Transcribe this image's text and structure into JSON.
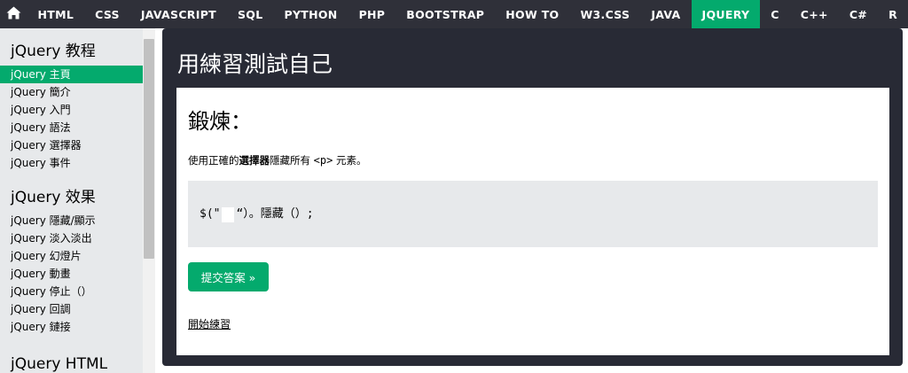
{
  "nav": {
    "home_icon": "home-icon",
    "items": [
      {
        "label": "HTML"
      },
      {
        "label": "CSS"
      },
      {
        "label": "JAVASCRIPT"
      },
      {
        "label": "SQL"
      },
      {
        "label": "PYTHON"
      },
      {
        "label": "PHP"
      },
      {
        "label": "BOOTSTRAP"
      },
      {
        "label": "HOW TO"
      },
      {
        "label": "W3.CSS"
      },
      {
        "label": "JAVA"
      },
      {
        "label": "JQUERY",
        "active": true
      },
      {
        "label": "C"
      },
      {
        "label": "C++"
      },
      {
        "label": "C#"
      },
      {
        "label": "R"
      }
    ]
  },
  "sidebar": {
    "section1": {
      "heading": "jQuery 教程",
      "links": [
        "jQuery 主頁",
        "jQuery 簡介",
        "jQuery 入門",
        "jQuery 語法",
        "jQuery 選擇器",
        "jQuery 事件"
      ]
    },
    "section2": {
      "heading": "jQuery 效果",
      "links": [
        "jQuery 隱藏/顯示",
        "jQuery 淡入淡出",
        "jQuery 幻燈片",
        "jQuery 動畫",
        "jQuery 停止（）",
        "jQuery 回調",
        "jQuery 鏈接"
      ]
    },
    "section3": {
      "heading": "jQuery HTML"
    }
  },
  "main": {
    "title": "用練習測試自己",
    "exercise": {
      "heading": "鍛煉：",
      "instruction_prefix": "使用正確的",
      "instruction_bold": "選擇器",
      "instruction_middle": "隱藏所有 ",
      "instruction_code": "<p>",
      "instruction_suffix": " 元素。",
      "code_prefix": "$(\"",
      "code_suffix": "“）。隱藏（）;",
      "answer_value": "",
      "submit_label": "提交答案 »",
      "start_link": "開始練習"
    }
  },
  "colors": {
    "nav_bg": "#2f3039",
    "accent": "#04aa6d",
    "panel_bg": "#282a35",
    "sidebar_bg": "#e7e9eb"
  }
}
